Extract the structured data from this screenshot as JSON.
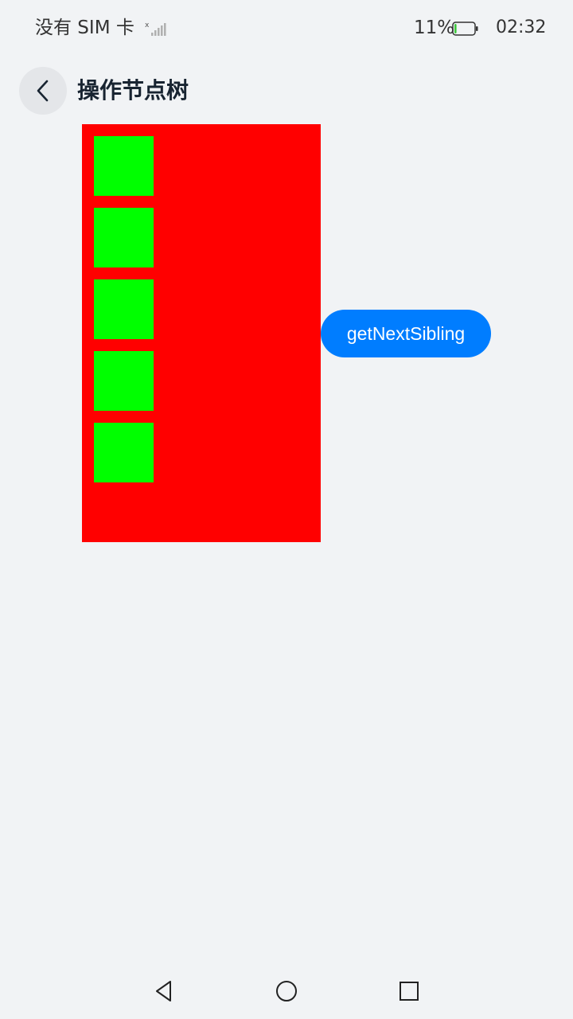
{
  "status_bar": {
    "carrier": "没有 SIM 卡",
    "battery_percent": "11%",
    "battery_level": 0.11,
    "time": "02:32"
  },
  "header": {
    "title": "操作节点树",
    "back_icon": "chevron-left-icon"
  },
  "node_tree": {
    "container_color": "#ff0000",
    "child_color": "#00ff00",
    "child_count": 5
  },
  "actions": {
    "next_sibling_label": "getNextSibling",
    "button_color": "#007dff"
  },
  "nav_bar": {
    "back_icon": "triangle-back-icon",
    "home_icon": "circle-home-icon",
    "recents_icon": "square-recents-icon"
  }
}
